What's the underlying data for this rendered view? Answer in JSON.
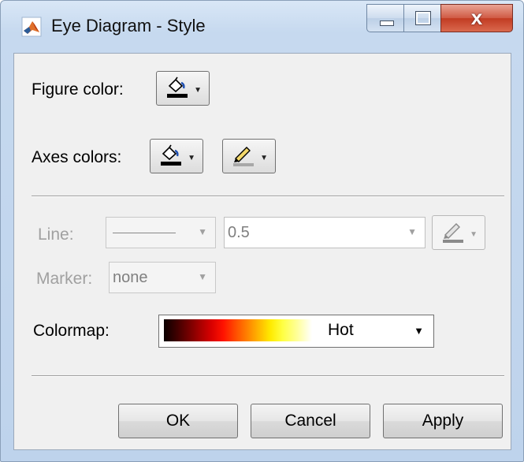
{
  "window": {
    "title": "Eye Diagram - Style"
  },
  "titlebar_buttons": {
    "minimize": "minimize-icon",
    "maximize": "maximize-icon",
    "close": "close-icon",
    "close_glyph": "x"
  },
  "figure": {
    "label": "Figure color:",
    "icon": "paint-bucket-icon"
  },
  "axes": {
    "label": "Axes colors:",
    "fill_icon": "paint-bucket-icon",
    "line_icon": "pen-icon"
  },
  "line": {
    "label": "Line:",
    "width_value": "0.5",
    "color_icon": "pen-icon",
    "enabled": false
  },
  "marker": {
    "label": "Marker:",
    "value": "none",
    "enabled": false
  },
  "colormap": {
    "label": "Colormap:",
    "value": "Hot",
    "gradient": [
      "#0b0000",
      "#d80000",
      "#ff8000",
      "#ffeb00",
      "#ffffff"
    ]
  },
  "buttons": {
    "ok": "OK",
    "cancel": "Cancel",
    "apply": "Apply"
  },
  "colors": {
    "titlebar": "#c6d9ef",
    "close": "#c23b22",
    "panel": "#f0f0f0"
  }
}
